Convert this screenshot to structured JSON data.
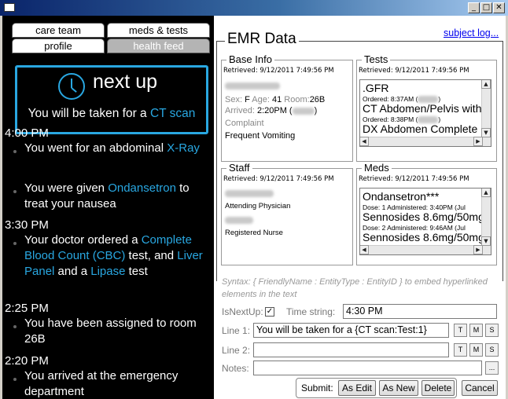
{
  "window": {
    "buttons": [
      "_",
      "□",
      "✕"
    ]
  },
  "tabs": {
    "care_team": "care team",
    "meds_tests": "meds & tests",
    "profile": "profile",
    "health_feed": "health feed"
  },
  "next_up": {
    "title": "next up",
    "line_prefix": "You will be taken for a ",
    "line_link": "CT scan"
  },
  "feed": [
    {
      "time": "4:00 PM",
      "items": [
        {
          "parts": [
            {
              "t": "You went for an abdominal "
            },
            {
              "t": "X-Ray",
              "link": true
            }
          ]
        },
        {
          "parts": [
            {
              "t": "You were given "
            },
            {
              "t": "Ondansetron",
              "link": true
            },
            {
              "t": " to treat your nausea"
            }
          ]
        }
      ]
    },
    {
      "time": "3:30 PM",
      "items": [
        {
          "parts": [
            {
              "t": "Your doctor ordered a "
            },
            {
              "t": "Complete Blood Count (CBC)",
              "link": true
            },
            {
              "t": " test, and "
            },
            {
              "t": "Liver Panel",
              "link": true
            },
            {
              "t": " and a "
            },
            {
              "t": "Lipase",
              "link": true
            },
            {
              "t": " test"
            }
          ]
        }
      ]
    },
    {
      "time": "2:25 PM",
      "items": [
        {
          "parts": [
            {
              "t": "You have been assigned to room 26B"
            }
          ]
        }
      ]
    },
    {
      "time": "2:20 PM",
      "items": [
        {
          "parts": [
            {
              "t": "You arrived at the emergency department"
            }
          ]
        }
      ]
    }
  ],
  "emr": {
    "title": "EMR Data",
    "subject_log": "subject log...",
    "base_info": {
      "title": "Base Info",
      "retrieved": "Retrieved: 9/12/2011 7:49:56 PM",
      "sex_label": "Sex:",
      "sex": "F",
      "age_label": "Age:",
      "age": "41",
      "room_label": "Room:",
      "room": "26B",
      "arrived_label": "Arrived:",
      "arrived": "2:20PM (",
      "arrived_close": ")",
      "complaint_label": "Complaint",
      "complaint": "Frequent Vomiting"
    },
    "tests": {
      "title": "Tests",
      "retrieved": "Retrieved: 9/12/2011 7:49:56 PM",
      "entries": [
        {
          "name": ".GFR",
          "detail": "Ordered: 8:37AM ("
        },
        {
          "name": "CT Abdomen/Pelvis with",
          "detail": "Ordered: 8:38PM ("
        },
        {
          "name": "DX Abdomen Complete",
          "detail": ""
        }
      ]
    },
    "staff": {
      "title": "Staff",
      "retrieved": "Retrieved: 9/12/2011 7:49:56 PM",
      "roles": [
        "Attending Physician",
        "Registered Nurse"
      ]
    },
    "meds": {
      "title": "Meds",
      "retrieved": "Retrieved: 9/12/2011 7:49:56 PM",
      "entries": [
        {
          "name": "Ondansetron***",
          "detail": "Dose: 1 Administered: 3:40PM (Jul"
        },
        {
          "name": "Sennosides 8.6mg/50mg",
          "detail": "Dose: 2 Administered: 9:46AM (Jul"
        },
        {
          "name": "Sennosides 8.6mg/50mg",
          "detail": ""
        }
      ]
    }
  },
  "form": {
    "syntax": "Syntax: { FriendlyName : EntityType : EntityID } to embed hyperlinked  elements in the text",
    "is_next_up_label": "IsNextUp:",
    "is_next_up_checked": "✓",
    "time_string_label": "Time string:",
    "time_string": "4:30 PM",
    "line1_label": "Line 1:",
    "line1": "You will be taken for a {CT scan:Test:1}",
    "line2_label": "Line 2:",
    "line2": "",
    "notes_label": "Notes:",
    "notes": "",
    "notes_browse": "...",
    "t_btn": "T",
    "m_btn": "M",
    "s_btn": "S",
    "submit_label": "Submit:",
    "as_edit": "As Edit",
    "as_new": "As New",
    "delete": "Delete",
    "cancel": "Cancel"
  },
  "colors": {
    "accent": "#29a7e1",
    "title_bar": "#0a246a"
  }
}
